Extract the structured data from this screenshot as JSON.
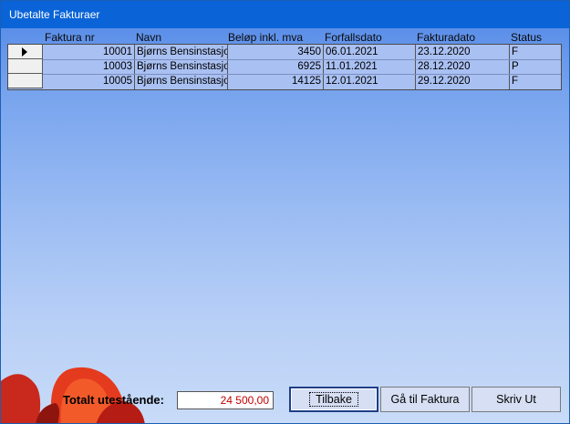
{
  "window": {
    "title": "Ubetalte Fakturaer"
  },
  "grid": {
    "columns": [
      "Faktura nr",
      "Navn",
      "Beløp inkl. mva",
      "Forfallsdato",
      "Fakturadato",
      "Status"
    ],
    "rows": [
      {
        "faktura_nr": "10001",
        "navn": "Bjørns Bensinstasjon",
        "belop": "3450",
        "forfall": "06.01.2021",
        "fakturadato": "23.12.2020",
        "status": "F"
      },
      {
        "faktura_nr": "10003",
        "navn": "Bjørns Bensinstasjon",
        "belop": "6925",
        "forfall": "11.01.2021",
        "fakturadato": "28.12.2020",
        "status": "P"
      },
      {
        "faktura_nr": "10005",
        "navn": "Bjørns Bensinstasjon",
        "belop": "14125",
        "forfall": "12.01.2021",
        "fakturadato": "29.12.2020",
        "status": "F"
      }
    ]
  },
  "footer": {
    "total_label": "Totalt utestående:",
    "total_value": "24 500,00",
    "buttons": {
      "back": "Tilbake",
      "goto": "Gå til Faktura",
      "print": "Skriv Ut"
    }
  },
  "colors": {
    "titlebar": "#0a64d8",
    "grid_bg": "#a9c0f2",
    "total_text": "#c00000"
  },
  "icons": {
    "current_row": "row-pointer-icon"
  }
}
